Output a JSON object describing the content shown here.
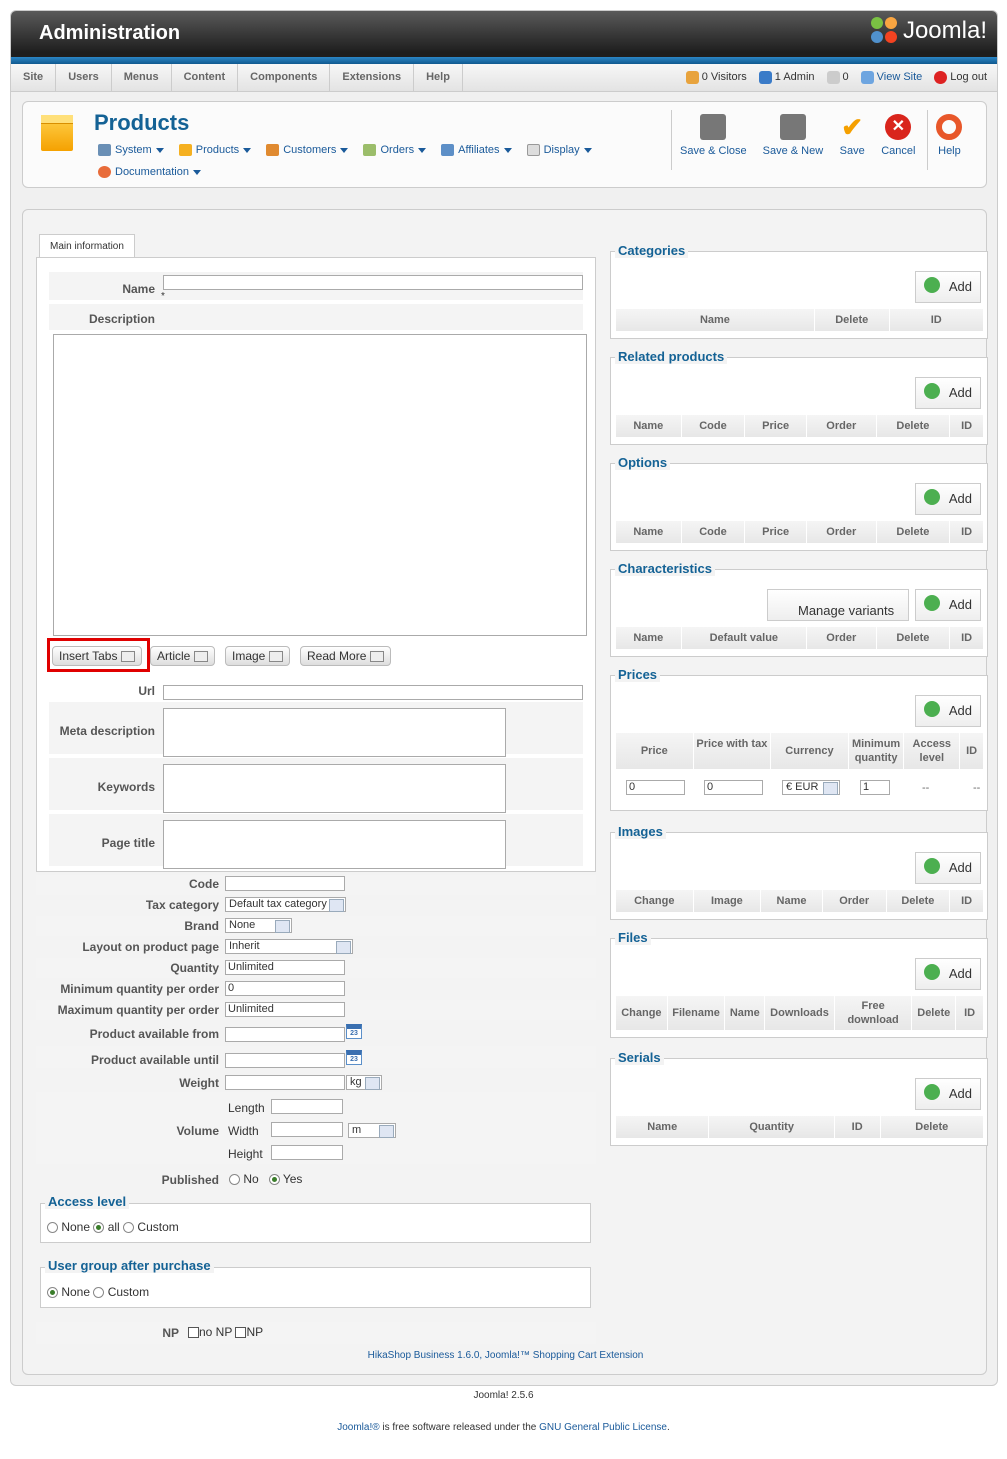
{
  "header": {
    "title": "Administration",
    "logo": "Joomla!"
  },
  "menubar": {
    "items": [
      "Site",
      "Users",
      "Menus",
      "Content",
      "Components",
      "Extensions",
      "Help"
    ]
  },
  "status": {
    "visitors": "0 Visitors",
    "admin": "1 Admin",
    "messages": "0",
    "view_site": "View Site",
    "logout": "Log out"
  },
  "toolbar": {
    "page_title": "Products",
    "submenu": [
      "System",
      "Products",
      "Customers",
      "Orders",
      "Affiliates",
      "Display",
      "Documentation"
    ],
    "buttons": {
      "save_close": "Save & Close",
      "save_new": "Save & New",
      "save": "Save",
      "cancel": "Cancel",
      "help": "Help"
    }
  },
  "tab": "Main information",
  "form": {
    "name_label": "Name",
    "required_mark": "*",
    "description_label": "Description",
    "editor_buttons": [
      "Insert Tabs",
      "Article",
      "Image",
      "Read More"
    ],
    "url_label": "Url",
    "meta_label": "Meta description",
    "keywords_label": "Keywords",
    "page_title_label": "Page title",
    "code_label": "Code",
    "tax_label": "Tax category",
    "tax_value": "Default tax category",
    "brand_label": "Brand",
    "brand_value": "None",
    "layout_label": "Layout on product page",
    "layout_value": "Inherit",
    "quantity_label": "Quantity",
    "quantity_value": "Unlimited",
    "minq_label": "Minimum quantity per order",
    "minq_value": "0",
    "maxq_label": "Maximum quantity per order",
    "maxq_value": "Unlimited",
    "from_label": "Product available from",
    "until_label": "Product available until",
    "cal_text": "23",
    "weight_label": "Weight",
    "weight_unit": "kg",
    "volume_label": "Volume",
    "length_label": "Length",
    "width_label": "Width",
    "height_label": "Height",
    "volume_unit": "m",
    "published_label": "Published",
    "no": "No",
    "yes": "Yes",
    "access_legend": "Access level",
    "access_none": "None",
    "access_all": "all",
    "access_custom": "Custom",
    "group_legend": "User group after purchase",
    "group_none": "None",
    "group_custom": "Custom",
    "np_label": "NP",
    "np_no": "no NP",
    "np_np": "NP",
    "credit": "HikaShop Business 1.6.0, Joomla!™ Shopping Cart Extension"
  },
  "panels": {
    "add": "Add",
    "manage_variants": "Manage variants",
    "categories": {
      "title": "Categories",
      "cols": [
        "Name",
        "Delete",
        "ID"
      ]
    },
    "related": {
      "title": "Related products",
      "cols": [
        "Name",
        "Code",
        "Price",
        "Order",
        "Delete",
        "ID"
      ]
    },
    "options": {
      "title": "Options",
      "cols": [
        "Name",
        "Code",
        "Price",
        "Order",
        "Delete",
        "ID"
      ]
    },
    "characteristics": {
      "title": "Characteristics",
      "cols": [
        "Name",
        "Default value",
        "Order",
        "Delete",
        "ID"
      ]
    },
    "prices": {
      "title": "Prices",
      "cols": [
        "Price",
        "Price with tax",
        "Currency",
        "Minimum quantity",
        "Access level",
        "ID"
      ],
      "row": {
        "price": "0",
        "price_tax": "0",
        "currency": "€ EUR",
        "min": "1",
        "access": "--",
        "id": "--"
      }
    },
    "images": {
      "title": "Images",
      "cols": [
        "Change",
        "Image",
        "Name",
        "Order",
        "Delete",
        "ID"
      ]
    },
    "files": {
      "title": "Files",
      "cols": [
        "Change",
        "Filename",
        "Name",
        "Downloads",
        "Free download",
        "Delete",
        "ID"
      ]
    },
    "serials": {
      "title": "Serials",
      "cols": [
        "Name",
        "Quantity",
        "ID",
        "Delete"
      ]
    }
  },
  "footer": {
    "version": "Joomla! 2.5.6",
    "license_a": "Joomla!®",
    "license_b": " is free software released under the ",
    "license_c": "GNU General Public License",
    "license_d": "."
  },
  "colors": {
    "accent": "#146295",
    "highlight": "#e00000"
  }
}
